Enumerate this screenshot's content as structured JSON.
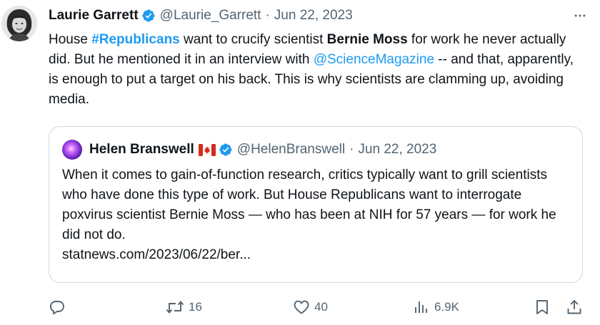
{
  "tweet": {
    "author_name": "Laurie Garrett",
    "author_handle": "@Laurie_Garrett",
    "separator": "·",
    "date": "Jun 22, 2023",
    "text": {
      "p1": "House ",
      "hashtag": "#Republicans",
      "p2": " want to crucify scientist ",
      "bold_name": "Bernie Moss",
      "p3": " for work he never actually did. But he mentioned it in an interview with ",
      "mention": "@ScienceMagazine",
      "p4": " -- and that, apparently, is enough to put a target on his back. This is why scientists are clamming up, avoiding media."
    }
  },
  "quote": {
    "author_name": "Helen Branswell",
    "author_handle": "@HelenBranswell",
    "separator": "·",
    "date": "Jun 22, 2023",
    "text": "When it comes to gain-of-function research, critics typically want to grill scientists who have done this type of work. But House Republicans want to interrogate poxvirus scientist Bernie Moss — who has been at NIH for 57 years — for work he did not do.",
    "link": "statnews.com/2023/06/22/ber..."
  },
  "actions": {
    "retweets": "16",
    "likes": "40",
    "views": "6.9K"
  },
  "colors": {
    "accent": "#1d9bf0",
    "secondary_text": "#536471",
    "border": "#cfd9de"
  },
  "icons": [
    "more-icon",
    "verified-badge-icon",
    "canada-flag-icon",
    "reply-icon",
    "retweet-icon",
    "like-icon",
    "views-icon",
    "bookmark-icon",
    "share-icon"
  ]
}
